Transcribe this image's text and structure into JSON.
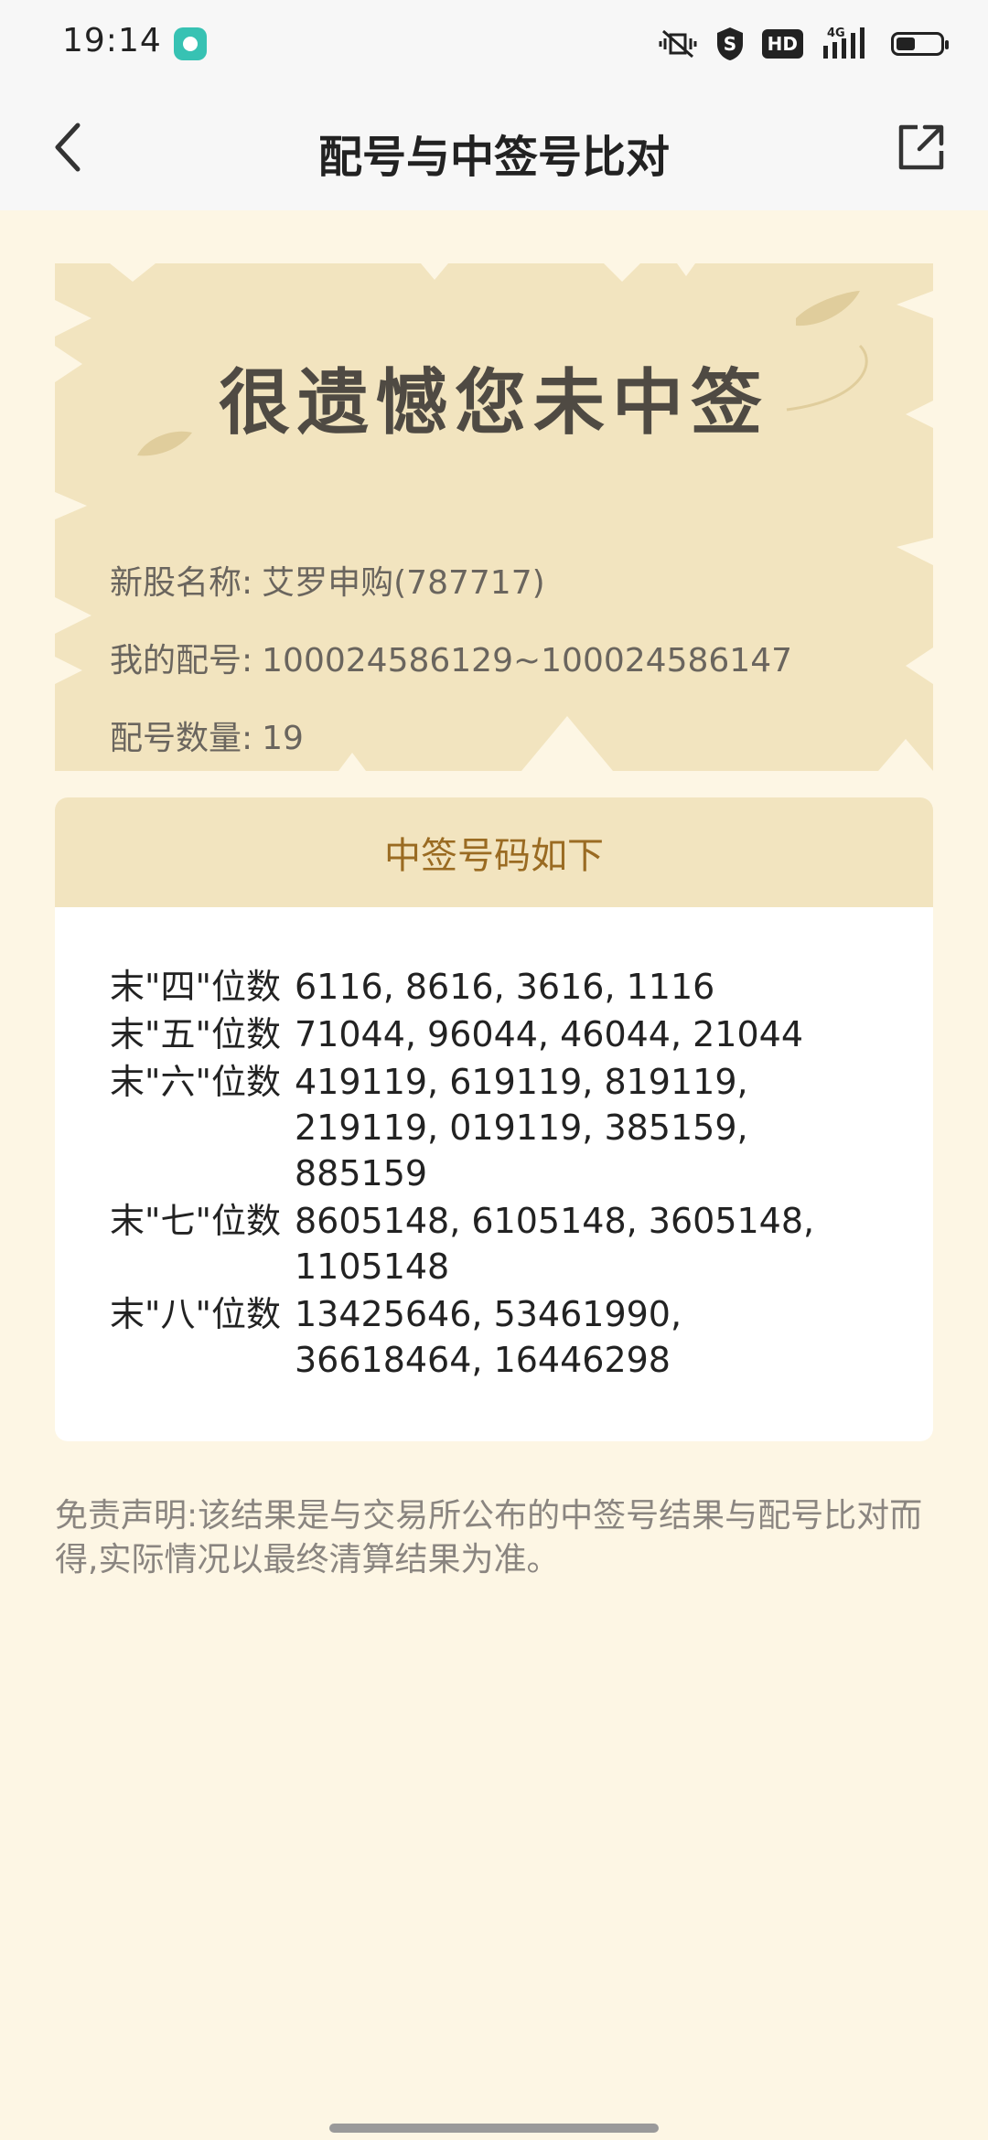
{
  "status_bar": {
    "time": "19:14",
    "app_icon": "music-app-icon",
    "icons": [
      "vibrate-mute-icon",
      "shield-s-icon",
      "hd-icon",
      "4g-signal-icon",
      "battery-icon"
    ],
    "hd_label": "HD",
    "network_label": "4G"
  },
  "nav": {
    "title": "配号与中签号比对",
    "back_icon": "chevron-left-icon",
    "share_icon": "share-external-icon"
  },
  "banner": {
    "headline": "很遗憾您未中签",
    "stock_label": "新股名称:",
    "stock_value": "艾罗申购(787717)",
    "number_label": "我的配号:",
    "number_value": "100024586129~100024586147",
    "count_label": "配号数量:",
    "count_value": "19",
    "background_color": "#f2e4bf"
  },
  "results": {
    "header": "中签号码如下",
    "rows": [
      {
        "label": "末\"四\"位数",
        "values": "6116, 8616, 3616, 1116"
      },
      {
        "label": "末\"五\"位数",
        "values": "71044, 96044, 46044, 21044"
      },
      {
        "label": "末\"六\"位数",
        "values": "419119, 619119, 819119, 219119, 019119, 385159, 885159"
      },
      {
        "label": "末\"七\"位数",
        "values": "8605148, 6105148, 3605148, 1105148"
      },
      {
        "label": "末\"八\"位数",
        "values": "13425646, 53461990, 36618464, 16446298"
      }
    ],
    "header_color": "#9a6b22"
  },
  "disclaimer": "免责声明:该结果是与交易所公布的中签号结果与配号比对而得,实际情况以最终清算结果为准。",
  "colors": {
    "page_background": "#fdf6e4",
    "nav_background": "#f7f7f7",
    "accent_brown": "#9a6b22"
  }
}
